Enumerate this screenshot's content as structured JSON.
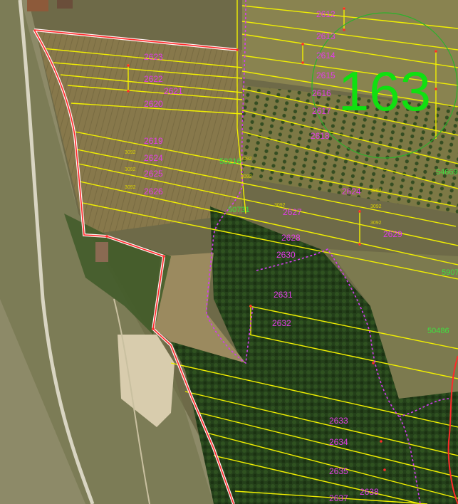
{
  "map": {
    "sheet_number": "163",
    "colors": {
      "parcel_line": "#f2f000",
      "boundary_red": "#ff2a2a",
      "boundary_white": "#fff2f2",
      "cadastral_dotted": "#d23cf0",
      "parcel_label": "#e23ce8",
      "id_green": "#3fe03f",
      "sheet_number": "#10e010",
      "small_code": "#d8d000"
    },
    "parcel_labels": [
      "2612",
      "2613",
      "2614",
      "2615",
      "2616",
      "2617",
      "2618",
      "2623",
      "2622",
      "2621",
      "2620",
      "2619",
      "2624",
      "2625",
      "2626",
      "2627",
      "2628",
      "2629",
      "2630",
      "2631",
      "2632",
      "2633",
      "2634",
      "2635",
      "2637",
      "2638",
      "2624"
    ],
    "ids": [
      "50216",
      "54669",
      "59071",
      "50486",
      "50731"
    ],
    "codes": [
      "3092",
      "3092",
      "3092",
      "3092",
      "3092",
      "3092",
      "3092",
      "3092",
      "3092"
    ]
  }
}
